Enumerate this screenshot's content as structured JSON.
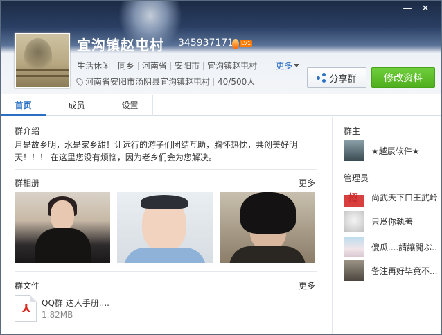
{
  "window": {
    "minimize": "—",
    "close": "✕"
  },
  "header": {
    "group_name": "宜沟镇赵屯村",
    "group_id": "345937171",
    "level": "LV1",
    "tags": [
      "生活休闲",
      "同乡",
      "河南省",
      "安阳市",
      "宜沟镇赵屯村"
    ],
    "more": "更多",
    "location": "河南省安阳市汤阴县宜沟镇赵屯村",
    "members_count": "40/500人",
    "share_button": "分享群",
    "edit_button": "修改资料"
  },
  "tabs": [
    "首页",
    "成员",
    "设置"
  ],
  "intro": {
    "title": "群介绍",
    "text": "月是故乡明，水是家乡甜！让远行的游子们团结互助，胸怀热忱，共创美好明天！！！ 在这里您没有烦恼，因为老乡们会为您解决。"
  },
  "album": {
    "title": "群相册",
    "more": "更多"
  },
  "files": {
    "title": "群文件",
    "more": "更多",
    "items": [
      {
        "name": "QQ群 达人手册....",
        "size": "1.82MB"
      }
    ]
  },
  "owner": {
    "title": "群主",
    "name": "★越辰软件★"
  },
  "admins": {
    "title": "管理员",
    "items": [
      {
        "name": "尚武天下口王武岭"
      },
      {
        "name": "只爲你執著"
      },
      {
        "name": "傻瓜....請讓開ぷ..."
      },
      {
        "name": "备注再好毕竟不..."
      }
    ]
  }
}
